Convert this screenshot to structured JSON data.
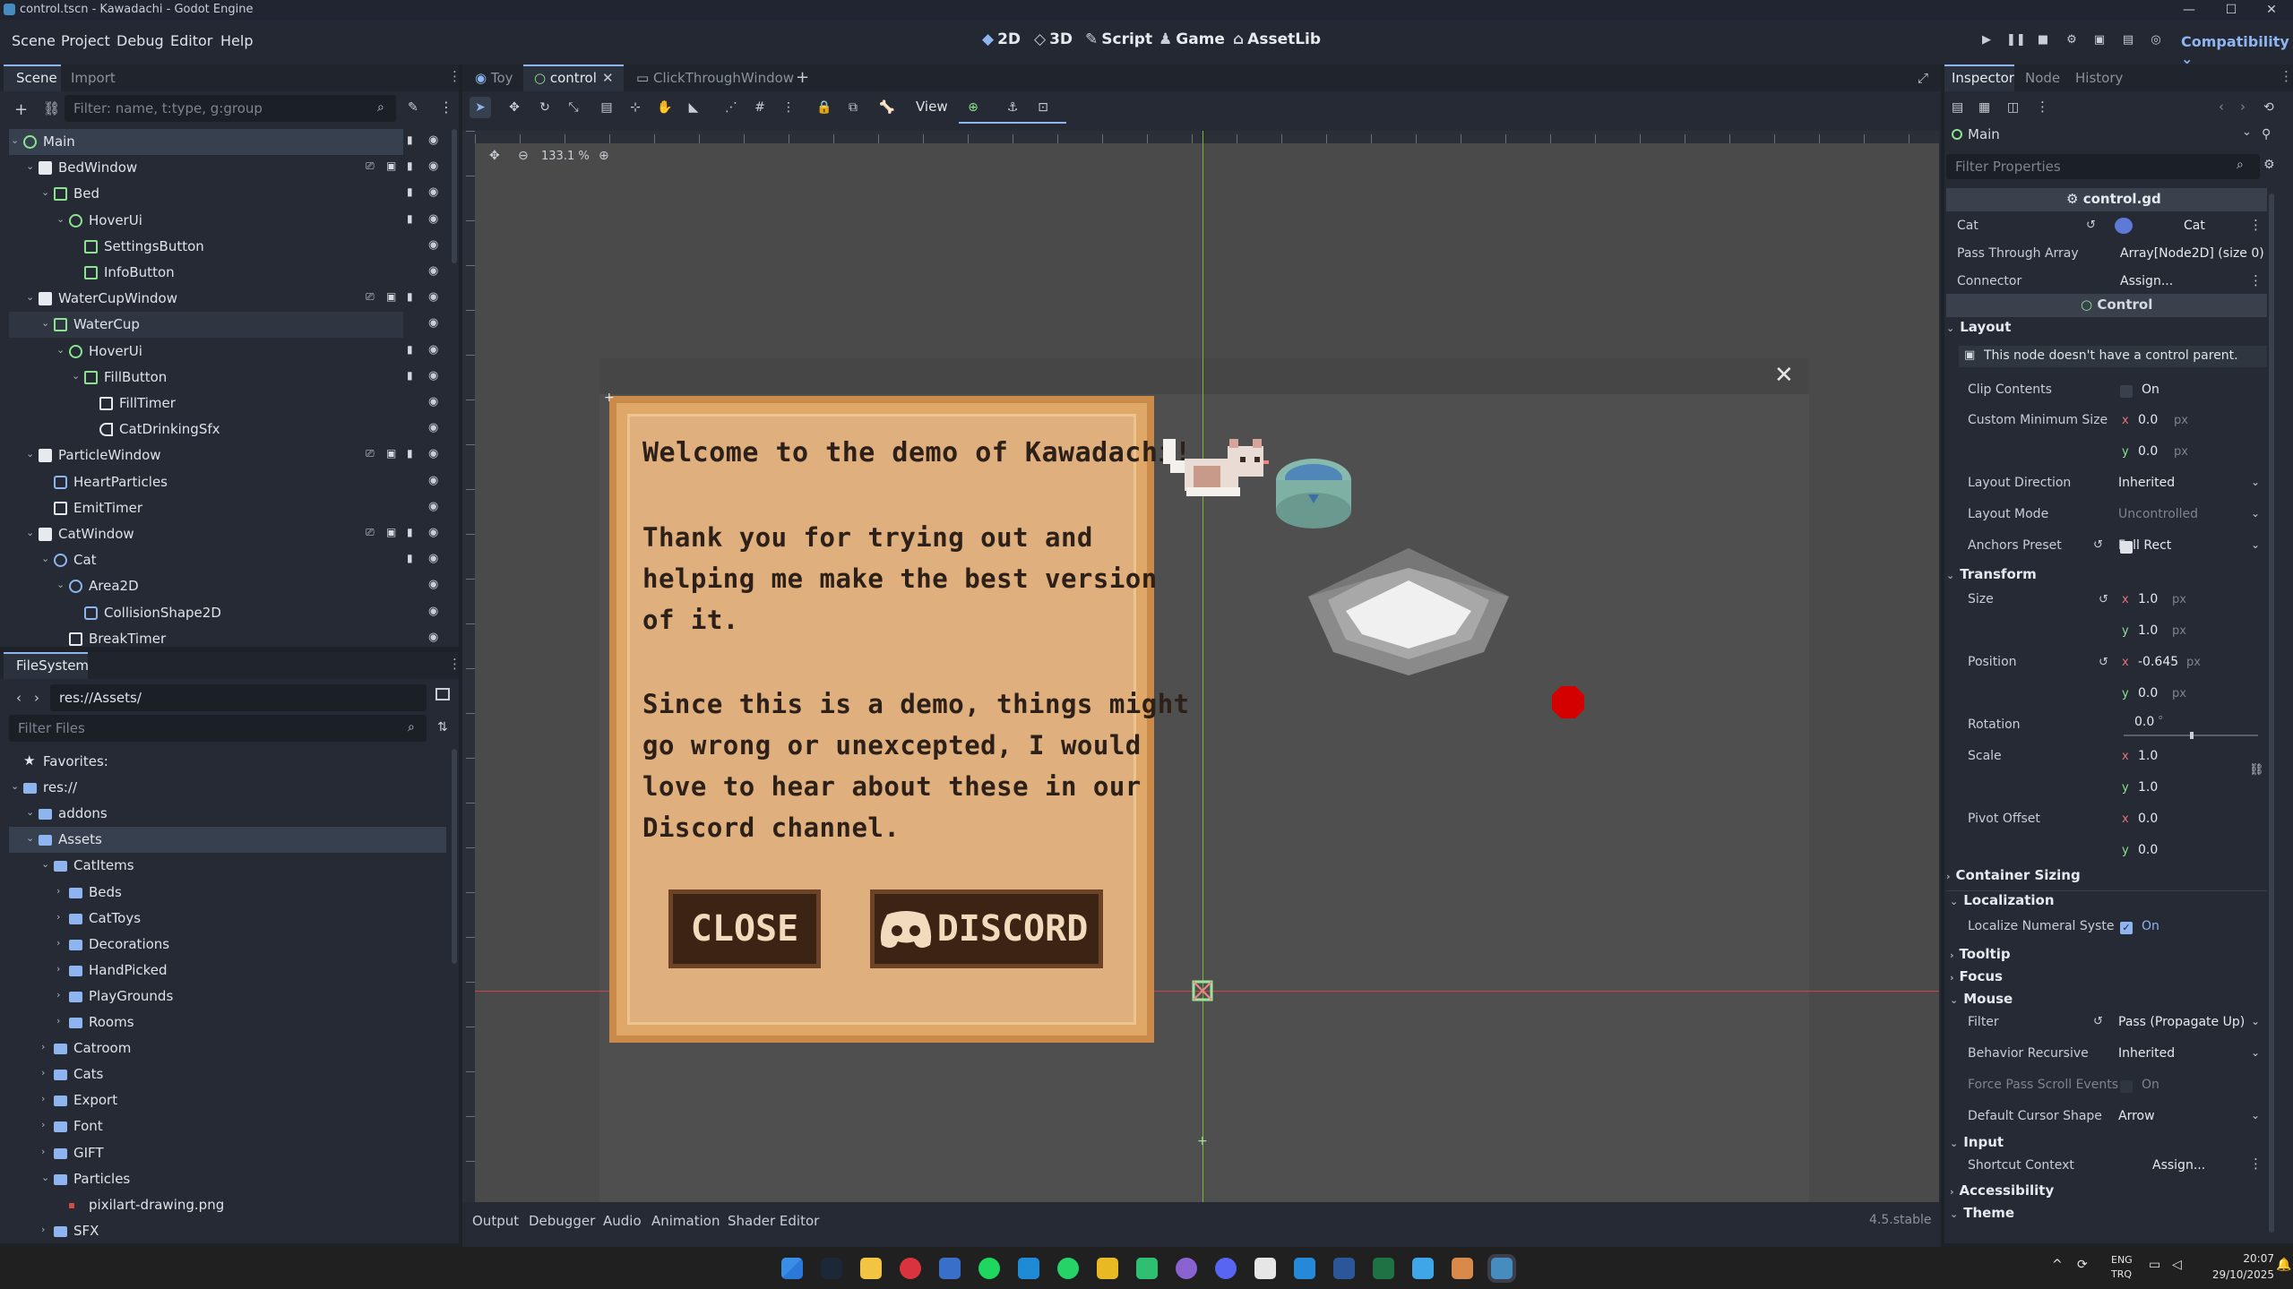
{
  "window": {
    "title": "control.tscn - Kawadachi - Godot Engine"
  },
  "menu": {
    "items": [
      "Scene",
      "Project",
      "Debug",
      "Editor",
      "Help"
    ]
  },
  "workspaces": [
    "2D",
    "3D",
    "Script",
    "Game",
    "AssetLib"
  ],
  "renderer": "Compatibility",
  "scene_dock": {
    "tabs": [
      "Scene",
      "Import"
    ],
    "filter_placeholder": "Filter: name, t:type, g:group",
    "tree": [
      {
        "name": "Main",
        "icon": "node",
        "depth": 0,
        "selected": true
      },
      {
        "name": "BedWindow",
        "icon": "window",
        "depth": 1
      },
      {
        "name": "Bed",
        "icon": "control",
        "depth": 2
      },
      {
        "name": "HoverUi",
        "icon": "node",
        "depth": 3
      },
      {
        "name": "SettingsButton",
        "icon": "control",
        "depth": 4
      },
      {
        "name": "InfoButton",
        "icon": "control",
        "depth": 4
      },
      {
        "name": "WaterCupWindow",
        "icon": "window",
        "depth": 1
      },
      {
        "name": "WaterCup",
        "icon": "control",
        "depth": 2,
        "selected2": true
      },
      {
        "name": "HoverUi",
        "icon": "node",
        "depth": 3
      },
      {
        "name": "FillButton",
        "icon": "control",
        "depth": 4
      },
      {
        "name": "FillTimer",
        "icon": "timer",
        "depth": 5
      },
      {
        "name": "CatDrinkingSfx",
        "icon": "audio",
        "depth": 5
      },
      {
        "name": "ParticleWindow",
        "icon": "window",
        "depth": 1
      },
      {
        "name": "HeartParticles",
        "icon": "particles",
        "depth": 2
      },
      {
        "name": "EmitTimer",
        "icon": "timer",
        "depth": 2
      },
      {
        "name": "CatWindow",
        "icon": "window",
        "depth": 1
      },
      {
        "name": "Cat",
        "icon": "node2d",
        "depth": 2
      },
      {
        "name": "Area2D",
        "icon": "area",
        "depth": 3
      },
      {
        "name": "CollisionShape2D",
        "icon": "shape",
        "depth": 4
      },
      {
        "name": "BreakTimer",
        "icon": "timer",
        "depth": 3
      }
    ]
  },
  "filesystem": {
    "tab": "FileSystem",
    "path": "res://Assets/",
    "filter_placeholder": "Filter Files",
    "items": [
      {
        "name": "Favorites:",
        "icon": "star",
        "depth": 0
      },
      {
        "name": "res://",
        "icon": "folder",
        "depth": 0
      },
      {
        "name": "addons",
        "icon": "folder",
        "depth": 1
      },
      {
        "name": "Assets",
        "icon": "folder",
        "depth": 1,
        "selected": true
      },
      {
        "name": "CatItems",
        "icon": "folder",
        "depth": 2
      },
      {
        "name": "Beds",
        "icon": "folder",
        "depth": 3
      },
      {
        "name": "CatToys",
        "icon": "folder",
        "depth": 3
      },
      {
        "name": "Decorations",
        "icon": "folder",
        "depth": 3
      },
      {
        "name": "HandPicked",
        "icon": "folder",
        "depth": 3
      },
      {
        "name": "PlayGrounds",
        "icon": "folder",
        "depth": 3
      },
      {
        "name": "Rooms",
        "icon": "folder",
        "depth": 3
      },
      {
        "name": "Catroom",
        "icon": "folder",
        "depth": 2
      },
      {
        "name": "Cats",
        "icon": "folder",
        "depth": 2
      },
      {
        "name": "Export",
        "icon": "folder",
        "depth": 2
      },
      {
        "name": "Font",
        "icon": "folder",
        "depth": 2
      },
      {
        "name": "GIFT",
        "icon": "folder",
        "depth": 2
      },
      {
        "name": "Particles",
        "icon": "folder",
        "depth": 2
      },
      {
        "name": "pixilart-drawing.png",
        "icon": "file",
        "depth": 3
      },
      {
        "name": "SFX",
        "icon": "folder",
        "depth": 2
      }
    ]
  },
  "editor_tabs": [
    {
      "name": "Toy",
      "active": false
    },
    {
      "name": "control",
      "active": true
    },
    {
      "name": "ClickThroughWindow",
      "active": false
    }
  ],
  "toolbar": {
    "view_label": "View",
    "zoom": "133.1 %"
  },
  "demo_dialog": {
    "line1": "Welcome to the demo of Kawadachi!",
    "para2": [
      "Thank you for trying out and",
      "helping me make the best version",
      "of it."
    ],
    "para3": [
      "Since this is a demo, things might",
      "go wrong or unexcepted, I would",
      "love to hear about these in our",
      "Discord channel."
    ],
    "close_label": "CLOSE",
    "discord_label": "DISCORD"
  },
  "bottom_panel": {
    "tabs": [
      "Output",
      "Debugger",
      "Audio",
      "Animation",
      "Shader Editor"
    ],
    "version": "4.5.stable"
  },
  "inspector": {
    "tabs": [
      "Inspector",
      "Node",
      "History"
    ],
    "node_path": "Main",
    "filter_placeholder": "Filter Properties",
    "script": "control.gd",
    "script_props": [
      {
        "name": "Cat",
        "value": "Cat"
      },
      {
        "name": "Pass Through Array",
        "value": "Array[Node2D] (size 0)"
      },
      {
        "name": "Connector",
        "value": "Assign..."
      }
    ],
    "class_header": "Control",
    "sections": {
      "layout": "Layout",
      "warning": "This node doesn't have a control parent.",
      "transform": "Transform",
      "container_sizing": "Container Sizing",
      "localization": "Localization",
      "tooltip": "Tooltip",
      "focus": "Focus",
      "mouse": "Mouse",
      "input": "Input",
      "accessibility": "Accessibility",
      "theme": "Theme"
    },
    "props": {
      "clip_contents": {
        "label": "Clip Contents",
        "value": "On"
      },
      "custom_min_size": {
        "label": "Custom Minimum Size",
        "x": "0.0",
        "y": "0.0",
        "unit": "px"
      },
      "layout_direction": {
        "label": "Layout Direction",
        "value": "Inherited"
      },
      "layout_mode": {
        "label": "Layout Mode",
        "value": "Uncontrolled"
      },
      "anchors_preset": {
        "label": "Anchors Preset",
        "value": "Full Rect"
      },
      "size": {
        "label": "Size",
        "x": "1.0",
        "y": "1.0"
      },
      "position": {
        "label": "Position",
        "x": "-0.645",
        "y": "0.0"
      },
      "rotation": {
        "label": "Rotation",
        "value": "0.0",
        "unit": "°"
      },
      "scale": {
        "label": "Scale",
        "x": "1.0",
        "y": "1.0"
      },
      "pivot_offset": {
        "label": "Pivot Offset",
        "x": "0.0",
        "y": "0.0"
      },
      "localize_numeral": {
        "label": "Localize Numeral Syste",
        "value": "On"
      },
      "filter": {
        "label": "Filter",
        "value": "Pass (Propagate Up)"
      },
      "behavior_recursive": {
        "label": "Behavior Recursive",
        "value": "Inherited"
      },
      "force_pass_scroll": {
        "label": "Force Pass Scroll Events",
        "value": "On"
      },
      "cursor_shape": {
        "label": "Default Cursor Shape",
        "value": "Arrow"
      },
      "shortcut_context": {
        "label": "Shortcut Context",
        "value": "Assign..."
      }
    }
  },
  "taskbar": {
    "lang1": "ENG",
    "lang2": "TRQ",
    "time": "20:07",
    "date": "29/10/2025"
  },
  "colors": {
    "accent": "#8eb5f0",
    "node_green": "#8be38f",
    "dialog_bg": "#e0a868",
    "dialog_text": "#2d2018",
    "button_bg": "#3c2414"
  }
}
